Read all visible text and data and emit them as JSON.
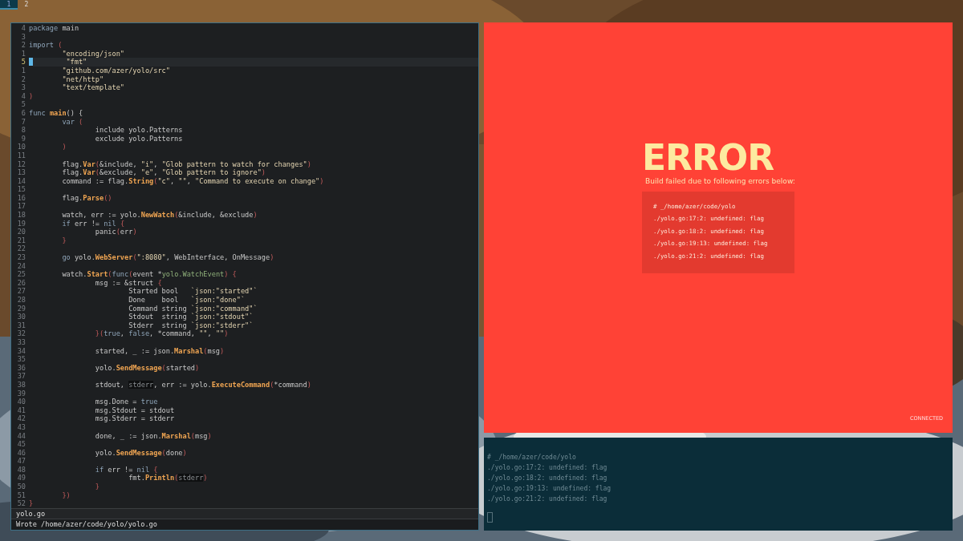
{
  "workspaces": [
    {
      "label": "1",
      "selected": true
    },
    {
      "label": "2",
      "selected": false
    }
  ],
  "editor": {
    "lines": [
      {
        "n": "4",
        "parts": [
          {
            "kind": "k",
            "text": "package"
          },
          {
            "kind": "t",
            "text": " main"
          }
        ]
      },
      {
        "n": "3"
      },
      {
        "n": "2",
        "parts": [
          {
            "kind": "k",
            "text": "import "
          },
          {
            "kind": "p",
            "text": "("
          }
        ]
      },
      {
        "n": "1",
        "parts": [
          {
            "kind": "s",
            "text": "\t\"encoding/json\""
          }
        ]
      },
      {
        "n": "5",
        "current": true,
        "parts": [
          {
            "kind": "s",
            "text": "\t\"fmt\""
          }
        ]
      },
      {
        "n": "1",
        "parts": [
          {
            "kind": "s",
            "text": "\t\"github.com/azer/yolo/src\""
          }
        ]
      },
      {
        "n": "2",
        "parts": [
          {
            "kind": "s",
            "text": "\t\"net/http\""
          }
        ]
      },
      {
        "n": "3",
        "parts": [
          {
            "kind": "s",
            "text": "\t\"text/template\""
          }
        ]
      },
      {
        "n": "4",
        "parts": [
          {
            "kind": "p",
            "text": ")"
          }
        ]
      },
      {
        "n": "5"
      },
      {
        "n": "6",
        "parts": [
          {
            "kind": "k",
            "text": "func "
          },
          {
            "kind": "f",
            "text": "main"
          },
          {
            "kind": "t",
            "text": "() {"
          }
        ]
      },
      {
        "n": "7",
        "parts": [
          {
            "kind": "k",
            "text": "\tvar "
          },
          {
            "kind": "p",
            "text": "("
          }
        ]
      },
      {
        "n": "8",
        "parts": [
          {
            "kind": "t",
            "text": "\t\tinclude yolo.Patterns"
          }
        ]
      },
      {
        "n": "9",
        "parts": [
          {
            "kind": "t",
            "text": "\t\texclude yolo.Patterns"
          }
        ]
      },
      {
        "n": "10",
        "parts": [
          {
            "kind": "p",
            "text": "\t)"
          }
        ]
      },
      {
        "n": "11"
      },
      {
        "n": "12",
        "parts": [
          {
            "kind": "t",
            "text": "\tflag."
          },
          {
            "kind": "f",
            "text": "Var"
          },
          {
            "kind": "p",
            "text": "("
          },
          {
            "kind": "t",
            "text": "&include, "
          },
          {
            "kind": "s",
            "text": "\"i\""
          },
          {
            "kind": "t",
            "text": ", "
          },
          {
            "kind": "s",
            "text": "\"Glob pattern to watch for changes\""
          },
          {
            "kind": "p",
            "text": ")"
          }
        ]
      },
      {
        "n": "13",
        "parts": [
          {
            "kind": "t",
            "text": "\tflag."
          },
          {
            "kind": "f",
            "text": "Var"
          },
          {
            "kind": "p",
            "text": "("
          },
          {
            "kind": "t",
            "text": "&exclude, "
          },
          {
            "kind": "s",
            "text": "\"e\""
          },
          {
            "kind": "t",
            "text": ", "
          },
          {
            "kind": "s",
            "text": "\"Glob pattern to ignore\""
          },
          {
            "kind": "p",
            "text": ")"
          }
        ]
      },
      {
        "n": "14",
        "parts": [
          {
            "kind": "t",
            "text": "\tcommand := flag."
          },
          {
            "kind": "f",
            "text": "String"
          },
          {
            "kind": "p",
            "text": "("
          },
          {
            "kind": "s",
            "text": "\"c\""
          },
          {
            "kind": "t",
            "text": ", "
          },
          {
            "kind": "s",
            "text": "\"\""
          },
          {
            "kind": "t",
            "text": ", "
          },
          {
            "kind": "s",
            "text": "\"Command to execute on change\""
          },
          {
            "kind": "p",
            "text": ")"
          }
        ]
      },
      {
        "n": "15"
      },
      {
        "n": "16",
        "parts": [
          {
            "kind": "t",
            "text": "\tflag."
          },
          {
            "kind": "f",
            "text": "Parse"
          },
          {
            "kind": "p",
            "text": "()"
          }
        ]
      },
      {
        "n": "17"
      },
      {
        "n": "18",
        "parts": [
          {
            "kind": "t",
            "text": "\twatch, err := yolo."
          },
          {
            "kind": "f",
            "text": "NewWatch"
          },
          {
            "kind": "p",
            "text": "("
          },
          {
            "kind": "t",
            "text": "&include, &exclude"
          },
          {
            "kind": "p",
            "text": ")"
          }
        ]
      },
      {
        "n": "19",
        "parts": [
          {
            "kind": "k",
            "text": "\tif"
          },
          {
            "kind": "t",
            "text": " err != "
          },
          {
            "kind": "k",
            "text": "nil "
          },
          {
            "kind": "p",
            "text": "{"
          }
        ]
      },
      {
        "n": "20",
        "parts": [
          {
            "kind": "t",
            "text": "\t\tpanic"
          },
          {
            "kind": "p",
            "text": "("
          },
          {
            "kind": "t",
            "text": "err"
          },
          {
            "kind": "p",
            "text": ")"
          }
        ]
      },
      {
        "n": "21",
        "parts": [
          {
            "kind": "p",
            "text": "\t}"
          }
        ]
      },
      {
        "n": "22"
      },
      {
        "n": "23",
        "parts": [
          {
            "kind": "k",
            "text": "\tgo"
          },
          {
            "kind": "t",
            "text": " yolo."
          },
          {
            "kind": "f",
            "text": "WebServer"
          },
          {
            "kind": "p",
            "text": "("
          },
          {
            "kind": "s",
            "text": "\":8080\""
          },
          {
            "kind": "t",
            "text": ", WebInterface, OnMessage"
          },
          {
            "kind": "p",
            "text": ")"
          }
        ]
      },
      {
        "n": "24"
      },
      {
        "n": "25",
        "parts": [
          {
            "kind": "t",
            "text": "\twatch."
          },
          {
            "kind": "f",
            "text": "Start"
          },
          {
            "kind": "p",
            "text": "("
          },
          {
            "kind": "k",
            "text": "func"
          },
          {
            "kind": "p",
            "text": "("
          },
          {
            "kind": "t",
            "text": "event *"
          },
          {
            "kind": "c",
            "text": "yolo.WatchEvent"
          },
          {
            "kind": "p",
            "text": ") {"
          }
        ]
      },
      {
        "n": "26",
        "parts": [
          {
            "kind": "t",
            "text": "\t\tmsg := &struct "
          },
          {
            "kind": "p",
            "text": "{"
          }
        ]
      },
      {
        "n": "27",
        "parts": [
          {
            "kind": "t",
            "text": "\t\t\tStarted bool   "
          },
          {
            "kind": "s",
            "text": "`json:\"started\"`"
          }
        ]
      },
      {
        "n": "28",
        "parts": [
          {
            "kind": "t",
            "text": "\t\t\tDone    bool   "
          },
          {
            "kind": "s",
            "text": "`json:\"done\"`"
          }
        ]
      },
      {
        "n": "29",
        "parts": [
          {
            "kind": "t",
            "text": "\t\t\tCommand string "
          },
          {
            "kind": "s",
            "text": "`json:\"command\"`"
          }
        ]
      },
      {
        "n": "30",
        "parts": [
          {
            "kind": "t",
            "text": "\t\t\tStdout  string "
          },
          {
            "kind": "s",
            "text": "`json:\"stdout\"`"
          }
        ]
      },
      {
        "n": "31",
        "parts": [
          {
            "kind": "t",
            "text": "\t\t\tStderr  string "
          },
          {
            "kind": "s",
            "text": "`json:\"stderr\"`"
          }
        ]
      },
      {
        "n": "32",
        "parts": [
          {
            "kind": "p",
            "text": "\t\t}("
          },
          {
            "kind": "k",
            "text": "true"
          },
          {
            "kind": "t",
            "text": ", "
          },
          {
            "kind": "k",
            "text": "false"
          },
          {
            "kind": "t",
            "text": ", *command, "
          },
          {
            "kind": "s",
            "text": "\"\""
          },
          {
            "kind": "t",
            "text": ", "
          },
          {
            "kind": "s",
            "text": "\"\""
          },
          {
            "kind": "p",
            "text": ")"
          }
        ]
      },
      {
        "n": "33"
      },
      {
        "n": "34",
        "parts": [
          {
            "kind": "t",
            "text": "\t\tstarted, _ := json."
          },
          {
            "kind": "f",
            "text": "Marshal"
          },
          {
            "kind": "p",
            "text": "("
          },
          {
            "kind": "t",
            "text": "msg"
          },
          {
            "kind": "p",
            "text": ")"
          }
        ]
      },
      {
        "n": "35"
      },
      {
        "n": "36",
        "parts": [
          {
            "kind": "t",
            "text": "\t\tyolo."
          },
          {
            "kind": "f",
            "text": "SendMessage"
          },
          {
            "kind": "p",
            "text": "("
          },
          {
            "kind": "t",
            "text": "started"
          },
          {
            "kind": "p",
            "text": ")"
          }
        ]
      },
      {
        "n": "37"
      },
      {
        "n": "38",
        "parts": [
          {
            "kind": "t",
            "text": "\t\tstdout, "
          },
          {
            "kind": "d",
            "text": "stderr"
          },
          {
            "kind": "t",
            "text": ", err := yolo."
          },
          {
            "kind": "f",
            "text": "ExecuteCommand"
          },
          {
            "kind": "p",
            "text": "("
          },
          {
            "kind": "t",
            "text": "*command"
          },
          {
            "kind": "p",
            "text": ")"
          }
        ]
      },
      {
        "n": "39"
      },
      {
        "n": "40",
        "parts": [
          {
            "kind": "t",
            "text": "\t\tmsg.Done = "
          },
          {
            "kind": "k",
            "text": "true"
          }
        ]
      },
      {
        "n": "41",
        "parts": [
          {
            "kind": "t",
            "text": "\t\tmsg.Stdout = stdout"
          }
        ]
      },
      {
        "n": "42",
        "parts": [
          {
            "kind": "t",
            "text": "\t\tmsg.Stderr = stderr"
          }
        ]
      },
      {
        "n": "43"
      },
      {
        "n": "44",
        "parts": [
          {
            "kind": "t",
            "text": "\t\tdone, _ := json."
          },
          {
            "kind": "f",
            "text": "Marshal"
          },
          {
            "kind": "p",
            "text": "("
          },
          {
            "kind": "t",
            "text": "msg"
          },
          {
            "kind": "p",
            "text": ")"
          }
        ]
      },
      {
        "n": "45"
      },
      {
        "n": "46",
        "parts": [
          {
            "kind": "t",
            "text": "\t\tyolo."
          },
          {
            "kind": "f",
            "text": "SendMessage"
          },
          {
            "kind": "p",
            "text": "("
          },
          {
            "kind": "t",
            "text": "done"
          },
          {
            "kind": "p",
            "text": ")"
          }
        ]
      },
      {
        "n": "47"
      },
      {
        "n": "48",
        "parts": [
          {
            "kind": "k",
            "text": "\t\tif"
          },
          {
            "kind": "t",
            "text": " err != "
          },
          {
            "kind": "k",
            "text": "nil "
          },
          {
            "kind": "p",
            "text": "{"
          }
        ]
      },
      {
        "n": "49",
        "parts": [
          {
            "kind": "t",
            "text": "\t\t\tfmt."
          },
          {
            "kind": "f",
            "text": "Println"
          },
          {
            "kind": "p",
            "text": "("
          },
          {
            "kind": "d",
            "text": "stderr"
          },
          {
            "kind": "p",
            "text": ")"
          }
        ]
      },
      {
        "n": "50",
        "parts": [
          {
            "kind": "p",
            "text": "\t\t}"
          }
        ]
      },
      {
        "n": "51",
        "parts": [
          {
            "kind": "p",
            "text": "\t})"
          }
        ]
      },
      {
        "n": "52",
        "parts": [
          {
            "kind": "p",
            "text": "}"
          }
        ]
      }
    ],
    "status_bar": "yolo.go",
    "message": "Wrote /home/azer/code/yolo/yolo.go"
  },
  "browser": {
    "title": "ERROR",
    "subtitle": "Build failed due to following errors below:",
    "errors": [
      "# _/home/azer/code/yolo",
      "./yolo.go:17:2: undefined: flag",
      "./yolo.go:18:2: undefined: flag",
      "./yolo.go:19:13: undefined: flag",
      "./yolo.go:21:2: undefined: flag"
    ],
    "status": "CONNECTED"
  },
  "terminal": {
    "lines": [
      "# _/home/azer/code/yolo",
      "./yolo.go:17:2: undefined: flag",
      "./yolo.go:18:2: undefined: flag",
      "./yolo.go:19:13: undefined: flag",
      "./yolo.go:21:2: undefined: flag"
    ]
  }
}
